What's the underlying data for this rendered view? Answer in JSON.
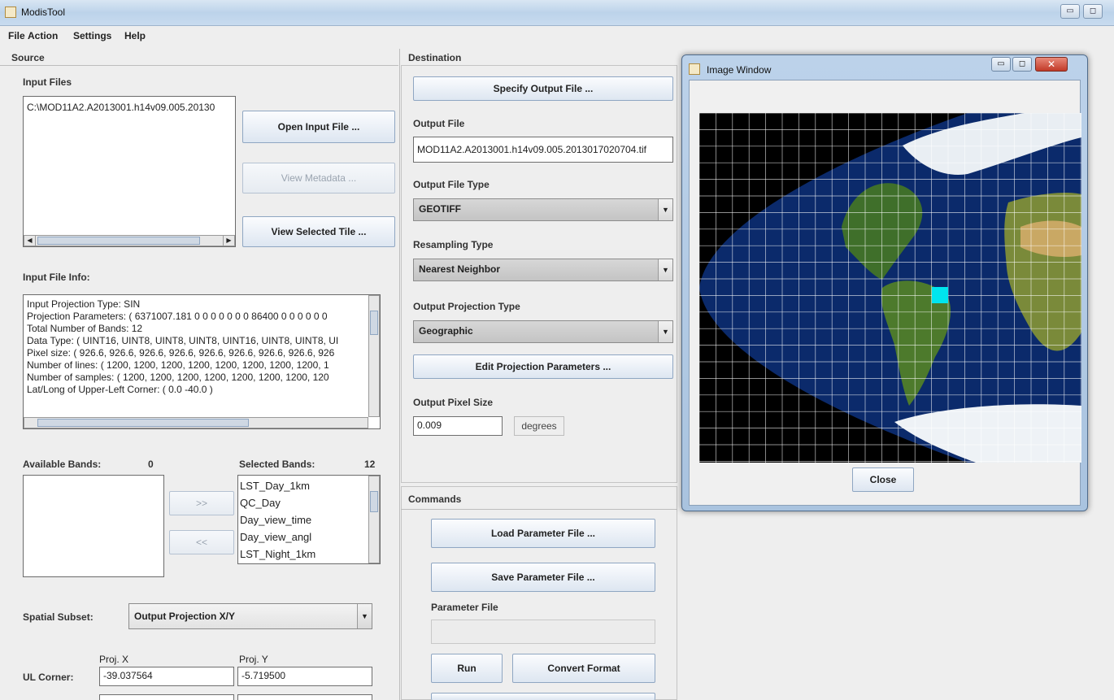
{
  "window": {
    "title": "ModisTool",
    "minimize": "▭",
    "maximize": "◻"
  },
  "menu": [
    "File",
    "Action",
    "Settings",
    "Help"
  ],
  "source": {
    "label": "Source",
    "input_files_label": "Input Files",
    "input_files": [
      "C:\\MOD11A2.A2013001.h14v09.005.20130"
    ],
    "open_input_file": "Open Input File ...",
    "view_metadata": "View Metadata ...",
    "view_selected_tile": "View Selected Tile ...",
    "input_file_info_label": "Input File Info:",
    "input_file_info": [
      "Input Projection Type: SIN",
      "Projection Parameters: ( 6371007.181 0 0 0 0 0 0 0 86400 0 0 0 0 0 0",
      "Total Number of Bands: 12",
      "Data Type: ( UINT16, UINT8, UINT8, UINT8, UINT16, UINT8, UINT8, UI",
      "Pixel size: ( 926.6, 926.6, 926.6, 926.6, 926.6, 926.6, 926.6, 926.6, 926",
      "Number of lines: ( 1200, 1200, 1200, 1200, 1200, 1200, 1200, 1200, 1",
      "Number of samples: ( 1200, 1200, 1200, 1200, 1200, 1200, 1200, 120",
      "Lat/Long of Upper-Left Corner: ( 0.0 -40.0 )"
    ],
    "available_bands_label": "Available Bands:",
    "available_bands_count": "0",
    "selected_bands_label": "Selected Bands:",
    "selected_bands_count": "12",
    "selected_bands": [
      "LST_Day_1km",
      "QC_Day",
      "Day_view_time",
      "Day_view_angl",
      "LST_Night_1km"
    ],
    "add_button": ">>",
    "remove_button": "<<",
    "spatial_subset_label": "Spatial Subset:",
    "spatial_subset_value": "Output Projection X/Y",
    "proj_x_label": "Proj. X",
    "proj_y_label": "Proj. Y",
    "ul_corner_label": "UL Corner:",
    "ul_x": "-39.037564",
    "ul_y": "-5.719500"
  },
  "destination": {
    "label": "Destination",
    "specify_output_file": "Specify Output File ...",
    "output_file_label": "Output File",
    "output_file": "MOD11A2.A2013001.h14v09.005.2013017020704.tif",
    "output_file_type_label": "Output File Type",
    "output_file_type": "GEOTIFF",
    "resampling_type_label": "Resampling Type",
    "resampling_type": "Nearest Neighbor",
    "output_projection_type_label": "Output Projection Type",
    "output_projection_type": "Geographic",
    "edit_projection_parameters": "Edit Projection Parameters ...",
    "output_pixel_size_label": "Output Pixel Size",
    "output_pixel_size": "0.009",
    "pixel_unit": "degrees"
  },
  "commands": {
    "label": "Commands",
    "load_parameter_file": "Load Parameter File ...",
    "save_parameter_file": "Save Parameter File ...",
    "parameter_file_label": "Parameter File",
    "parameter_file": "",
    "run": "Run",
    "convert_format": "Convert Format"
  },
  "image_window": {
    "title": "Image Window",
    "close": "Close",
    "highlight_color": "#00e5ee",
    "ocean_color": "#0b2a6b",
    "grid_color": "#ffffff"
  }
}
